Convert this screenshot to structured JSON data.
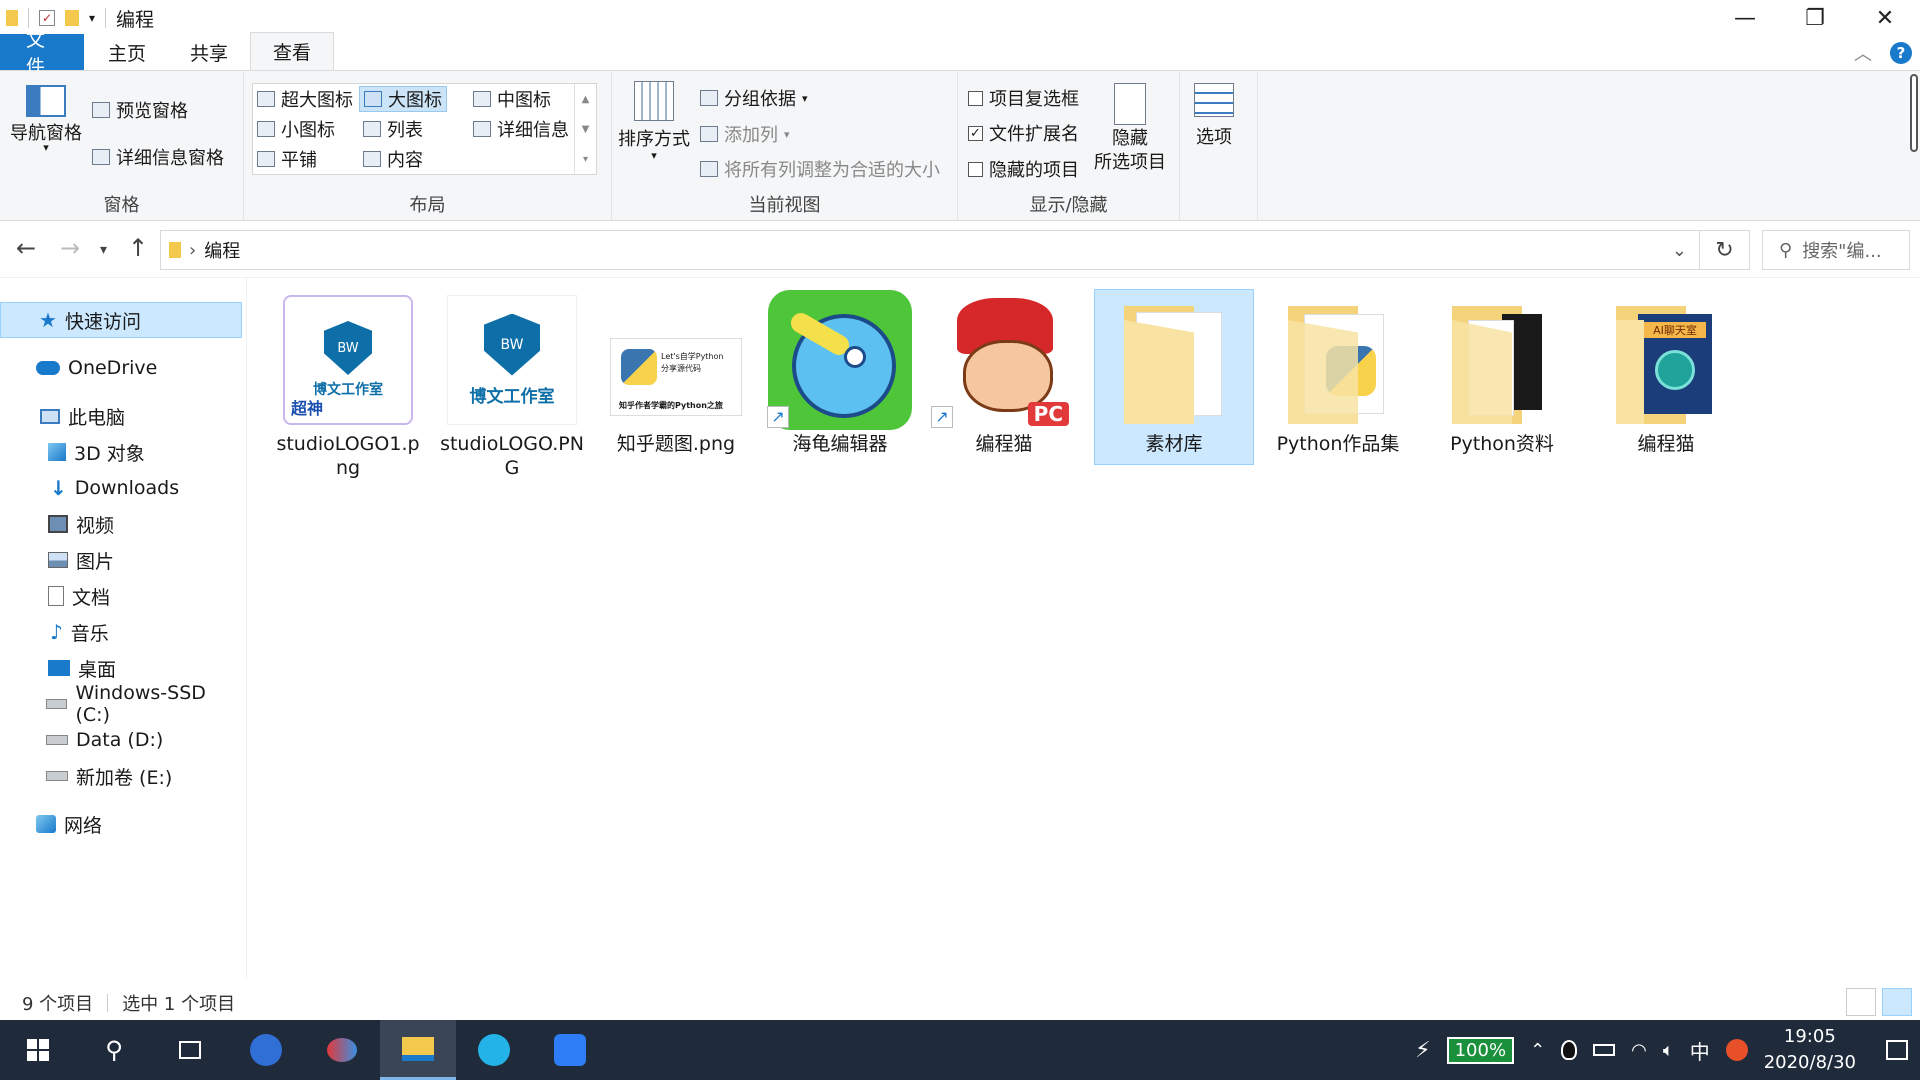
{
  "window": {
    "title": "编程"
  },
  "tabs": [
    {
      "label": "文件"
    },
    {
      "label": "主页"
    },
    {
      "label": "共享"
    },
    {
      "label": "查看"
    }
  ],
  "ribbon": {
    "pane": {
      "nav_pane": "导航窗格",
      "preview_pane": "预览窗格",
      "details_pane": "详细信息窗格",
      "label": "窗格"
    },
    "layout": {
      "extra_large": "超大图标",
      "large": "大图标",
      "medium": "中图标",
      "small": "小图标",
      "list": "列表",
      "details": "详细信息",
      "tiles": "平铺",
      "content": "内容",
      "label": "布局"
    },
    "current_view": {
      "sort_by": "排序方式",
      "group_by": "分组依据",
      "add_columns": "添加列",
      "size_all_columns": "将所有列调整为合适的大小",
      "label": "当前视图"
    },
    "show_hide": {
      "item_checkboxes": "项目复选框",
      "file_extensions": "文件扩展名",
      "hidden_items": "隐藏的项目",
      "hide_selected_line1": "隐藏",
      "hide_selected_line2": "所选项目",
      "label": "显示/隐藏",
      "item_checkboxes_checked": false,
      "file_extensions_checked": true,
      "hidden_items_checked": false
    },
    "options": "选项"
  },
  "address": {
    "path": "编程",
    "search_placeholder": "搜索\"编..."
  },
  "nav": {
    "quick_access": "快速访问",
    "onedrive": "OneDrive",
    "this_pc": "此电脑",
    "objects3d": "3D 对象",
    "downloads": "Downloads",
    "videos": "视频",
    "pictures": "图片",
    "documents": "文档",
    "music": "音乐",
    "desktop": "桌面",
    "drive_c": "Windows-SSD (C:)",
    "drive_d": "Data (D:)",
    "drive_e": "新加卷 (E:)",
    "network": "网络"
  },
  "files": [
    {
      "name": "studioLOGO1.png",
      "kind": "image-logo"
    },
    {
      "name": "studioLOGO.PNG",
      "kind": "image-logo"
    },
    {
      "name": "知乎题图.png",
      "kind": "image-python"
    },
    {
      "name": "海龟编辑器",
      "kind": "shortcut-app"
    },
    {
      "name": "编程猫",
      "kind": "shortcut-app"
    },
    {
      "name": "素材库",
      "kind": "folder",
      "selected": true
    },
    {
      "name": "Python作品集",
      "kind": "folder"
    },
    {
      "name": "Python资料",
      "kind": "folder"
    },
    {
      "name": "编程猫",
      "kind": "folder"
    }
  ],
  "thumb_text": {
    "logo1_top": "博文工作室",
    "logo1_bottom": "超神",
    "logo2": "博文工作室",
    "zhihu_line1": "Let's自学Python",
    "zhihu_line2": "分享源代码",
    "zhihu_bottom": "知乎作者学霸的Python之旅",
    "bw": "BW",
    "pc_badge": "PC",
    "ai_chat": "AI聊天室"
  },
  "status": {
    "count": "9 个项目",
    "selected": "选中 1 个项目"
  },
  "taskbar": {
    "battery": "100%",
    "ime": "中",
    "time": "19:05",
    "date": "2020/8/30"
  }
}
